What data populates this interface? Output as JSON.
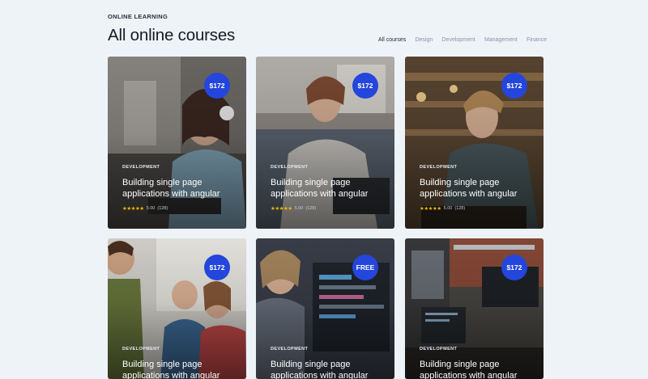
{
  "header": {
    "eyebrow": "ONLINE LEARNING",
    "title": "All online courses"
  },
  "filters": [
    "All courses",
    "Design",
    "Development",
    "Management",
    "Finance"
  ],
  "active_filter": "All courses",
  "colors": {
    "background": "#eef3f8",
    "price_badge": "#2446dc",
    "star": "#f2b705"
  },
  "courses": [
    {
      "price": "$172",
      "category": "DEVELOPMENT",
      "title": "Building single page applications with angular",
      "stars": "★★★★★",
      "rating": "5.00",
      "reviews": "(128)"
    },
    {
      "price": "$172",
      "category": "DEVELOPMENT",
      "title": "Building single page applications with angular",
      "stars": "★★★★★",
      "rating": "5.00",
      "reviews": "(128)"
    },
    {
      "price": "$172",
      "category": "DEVELOPMENT",
      "title": "Building single page applications with angular",
      "stars": "★★★★★",
      "rating": "5.00",
      "reviews": "(128)"
    },
    {
      "price": "$172",
      "category": "DEVELOPMENT",
      "title": "Building single page applications with angular"
    },
    {
      "price": "FREE",
      "category": "DEVELOPMENT",
      "title": "Building single page applications with angular"
    },
    {
      "price": "$172",
      "category": "DEVELOPMENT",
      "title": "Building single page applications with angular"
    }
  ]
}
